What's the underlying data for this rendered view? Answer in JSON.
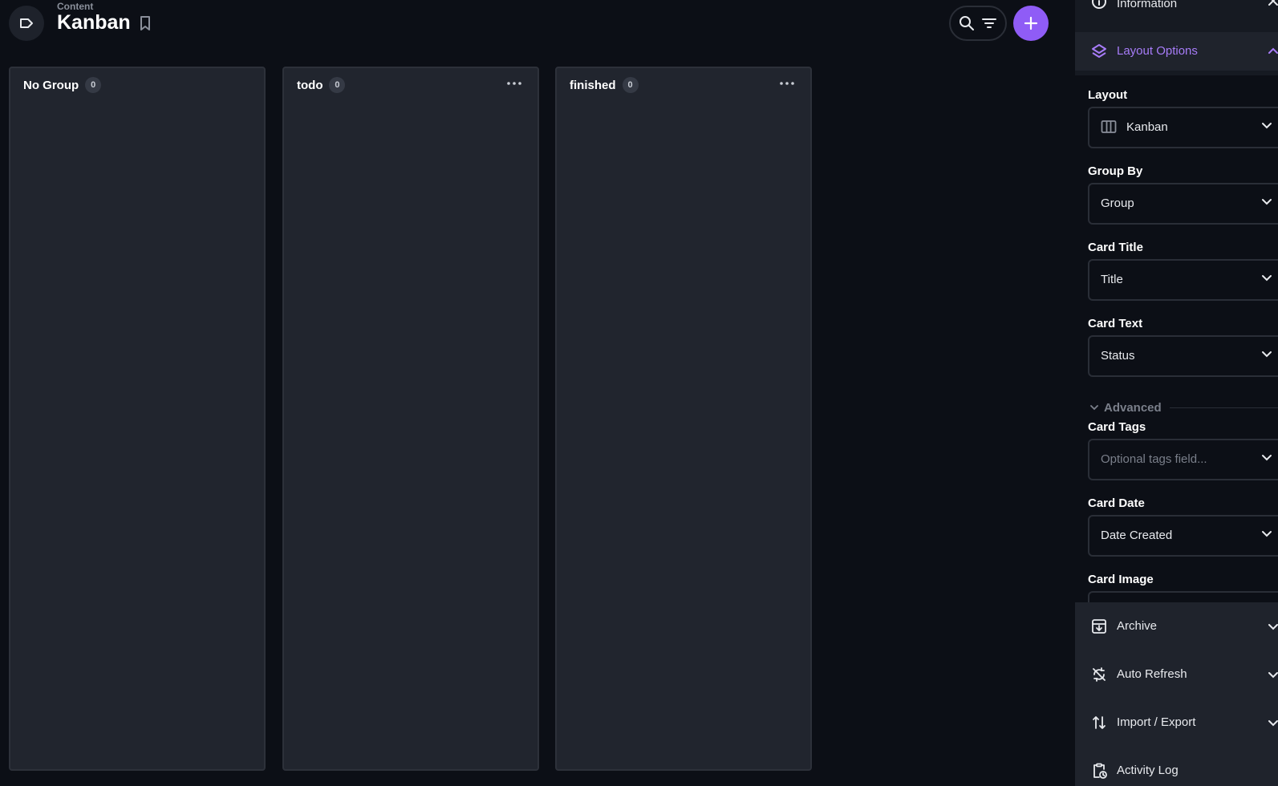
{
  "header": {
    "breadcrumb": "Content",
    "title": "Kanban"
  },
  "kanban": {
    "columns": [
      {
        "title": "No Group",
        "count": "0",
        "has_menu": false
      },
      {
        "title": "todo",
        "count": "0",
        "has_menu": true
      },
      {
        "title": "finished",
        "count": "0",
        "has_menu": true
      }
    ]
  },
  "sidebar": {
    "information_label": "Information",
    "layout_options_label": "Layout Options",
    "layout": {
      "label": "Layout",
      "value": "Kanban"
    },
    "group_by": {
      "label": "Group By",
      "value": "Group"
    },
    "card_title": {
      "label": "Card Title",
      "value": "Title"
    },
    "card_text": {
      "label": "Card Text",
      "value": "Status"
    },
    "advanced_label": "Advanced",
    "card_tags": {
      "label": "Card Tags",
      "placeholder": "Optional tags field..."
    },
    "card_date": {
      "label": "Card Date",
      "value": "Date Created"
    },
    "card_image": {
      "label": "Card Image",
      "value": ""
    },
    "sections": {
      "archive": "Archive",
      "auto_refresh": "Auto Refresh",
      "import_export": "Import / Export",
      "activity_log": "Activity Log"
    }
  },
  "colors": {
    "accent": "#8f5cf6",
    "accent_text": "#a77cf8",
    "background": "#0c0f16",
    "column": "#21252e",
    "sidebar": "#161a22"
  },
  "icons": {
    "nav": "label-tag-icon",
    "bookmark": "bookmark-icon",
    "search": "search-icon",
    "filter": "filter-icon",
    "add": "plus-icon"
  }
}
